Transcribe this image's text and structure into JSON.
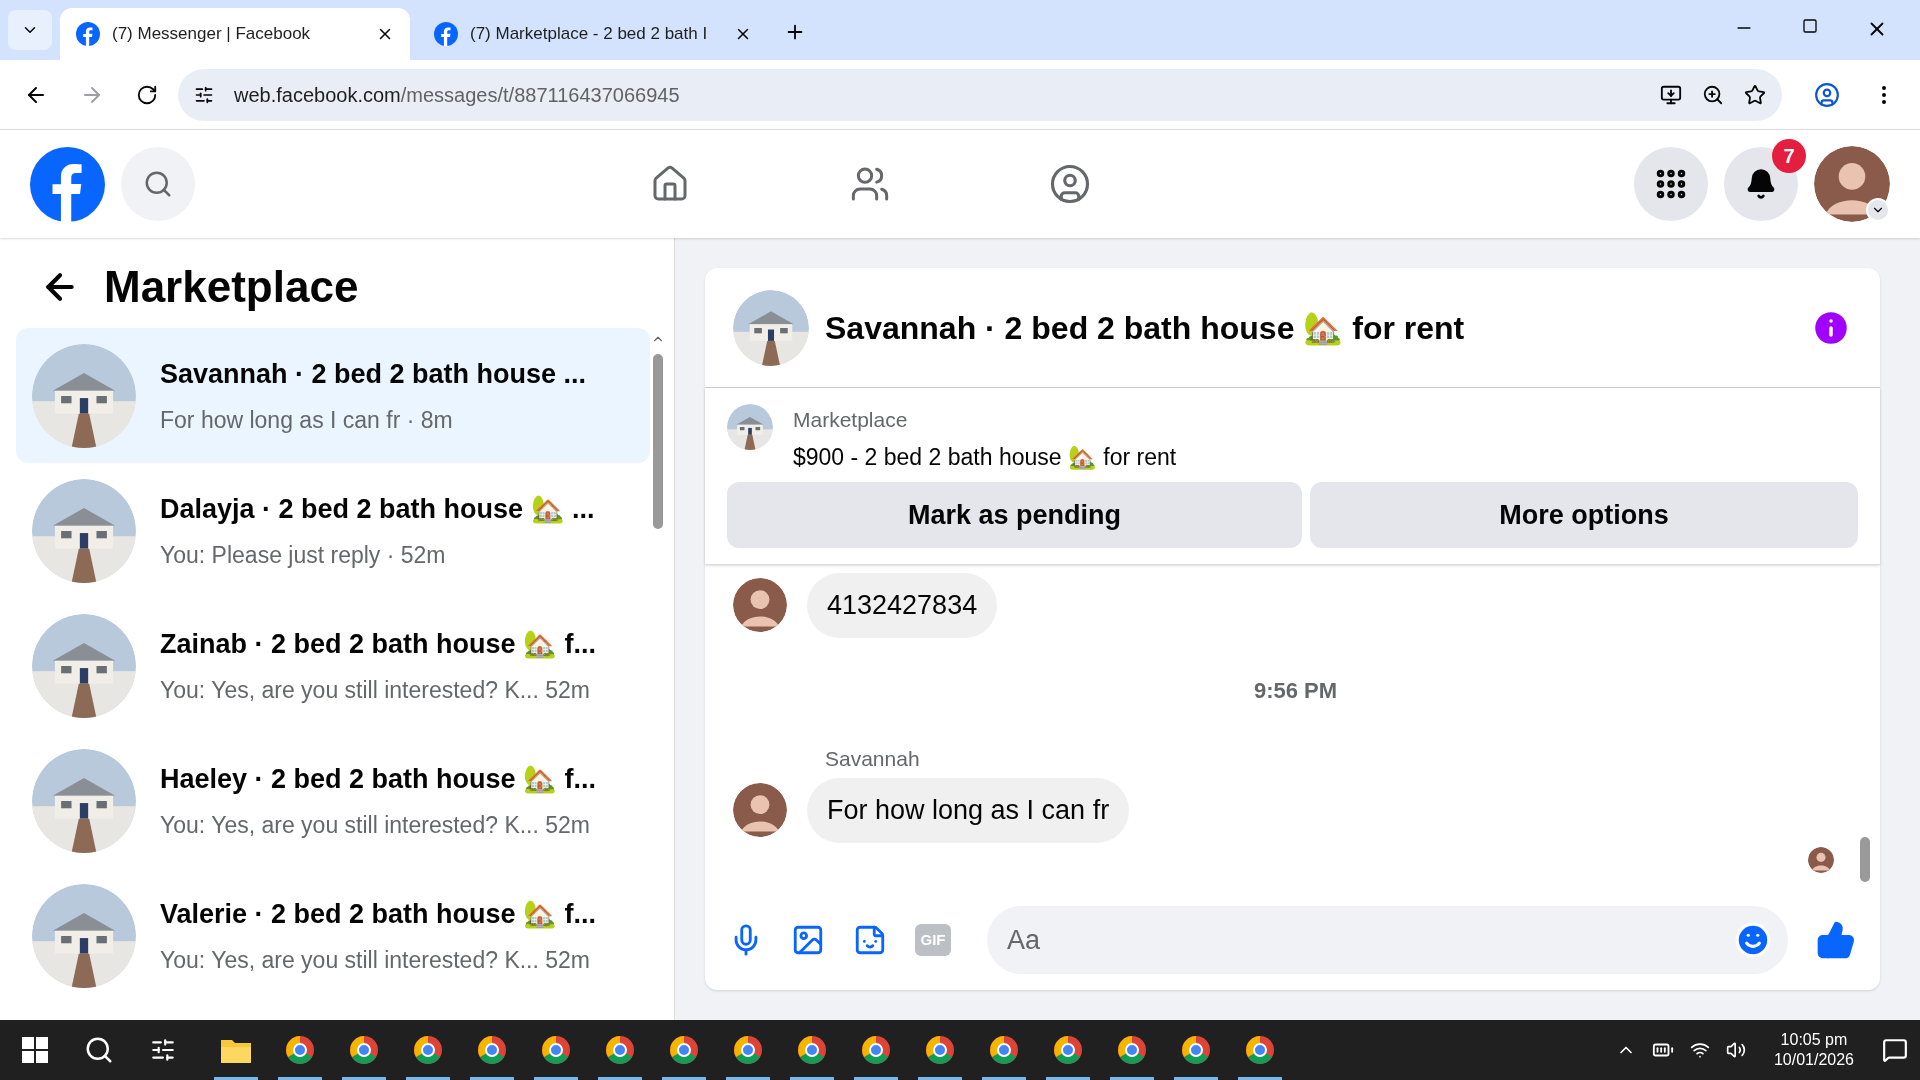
{
  "browser": {
    "tabs": [
      {
        "title": "(7) Messenger | Facebook",
        "selected": true
      },
      {
        "title": "(7) Marketplace - 2 bed 2 bath I",
        "selected": false
      }
    ],
    "url": {
      "host": "web.facebook.com",
      "path": "/messages/t/887116437066945"
    }
  },
  "header": {
    "nav": [
      {
        "kind": "home",
        "selected": false
      },
      {
        "kind": "friends",
        "selected": false
      },
      {
        "kind": "groups",
        "selected": false
      }
    ],
    "notifications_badge": "7"
  },
  "sidebar": {
    "title": "Marketplace",
    "conversations": [
      {
        "title": "Savannah · 2 bed 2 bath house ...",
        "preview": "For how long as I can fr · 8m",
        "selected": true
      },
      {
        "title": "Dalayja · 2 bed 2 bath house 🏡 ...",
        "preview": "You: Please just reply · 52m",
        "selected": false
      },
      {
        "title": "Zainab · 2 bed 2 bath house 🏡 f...",
        "preview": "You: Yes, are you still interested? K... 52m",
        "selected": false
      },
      {
        "title": "Haeley · 2 bed 2 bath house 🏡 f...",
        "preview": "You: Yes, are you still interested? K... 52m",
        "selected": false
      },
      {
        "title": "Valerie · 2 bed 2 bath house 🏡 f...",
        "preview": "You: Yes, are you still interested? K... 52m",
        "selected": false
      }
    ]
  },
  "chat": {
    "title": "Savannah · 2 bed 2 bath house 🏡 for rent",
    "listing": {
      "label": "Marketplace",
      "name": "$900 - 2 bed 2 bath house 🏡 for rent",
      "buttons": [
        "Mark as pending",
        "More options"
      ]
    },
    "messages": [
      {
        "kind": "bubble",
        "text": "4132427834"
      },
      {
        "kind": "time",
        "text": "9:56 PM"
      },
      {
        "kind": "sender",
        "text": "Savannah"
      },
      {
        "kind": "bubble",
        "text": "For how long as I can fr"
      }
    ],
    "composer": {
      "gif_label": "GIF",
      "placeholder": "Aa"
    }
  },
  "taskbar": {
    "apps": [
      {
        "kind": "explorer-folder",
        "running": true
      },
      {
        "kind": "browser",
        "running": true
      },
      {
        "kind": "browser",
        "running": true
      },
      {
        "kind": "browser",
        "running": true
      },
      {
        "kind": "browser",
        "running": true
      },
      {
        "kind": "browser",
        "running": true
      },
      {
        "kind": "browser",
        "running": true
      },
      {
        "kind": "browser",
        "running": true
      },
      {
        "kind": "browser",
        "running": true
      },
      {
        "kind": "browser",
        "running": true
      },
      {
        "kind": "browser",
        "running": true
      },
      {
        "kind": "browser",
        "running": true
      },
      {
        "kind": "browser",
        "running": true
      },
      {
        "kind": "browser",
        "running": true
      },
      {
        "kind": "browser",
        "running": true
      },
      {
        "kind": "browser",
        "running": true
      },
      {
        "kind": "browser",
        "running": true
      }
    ],
    "time": "10:05 pm",
    "date": "10/01/2026"
  }
}
